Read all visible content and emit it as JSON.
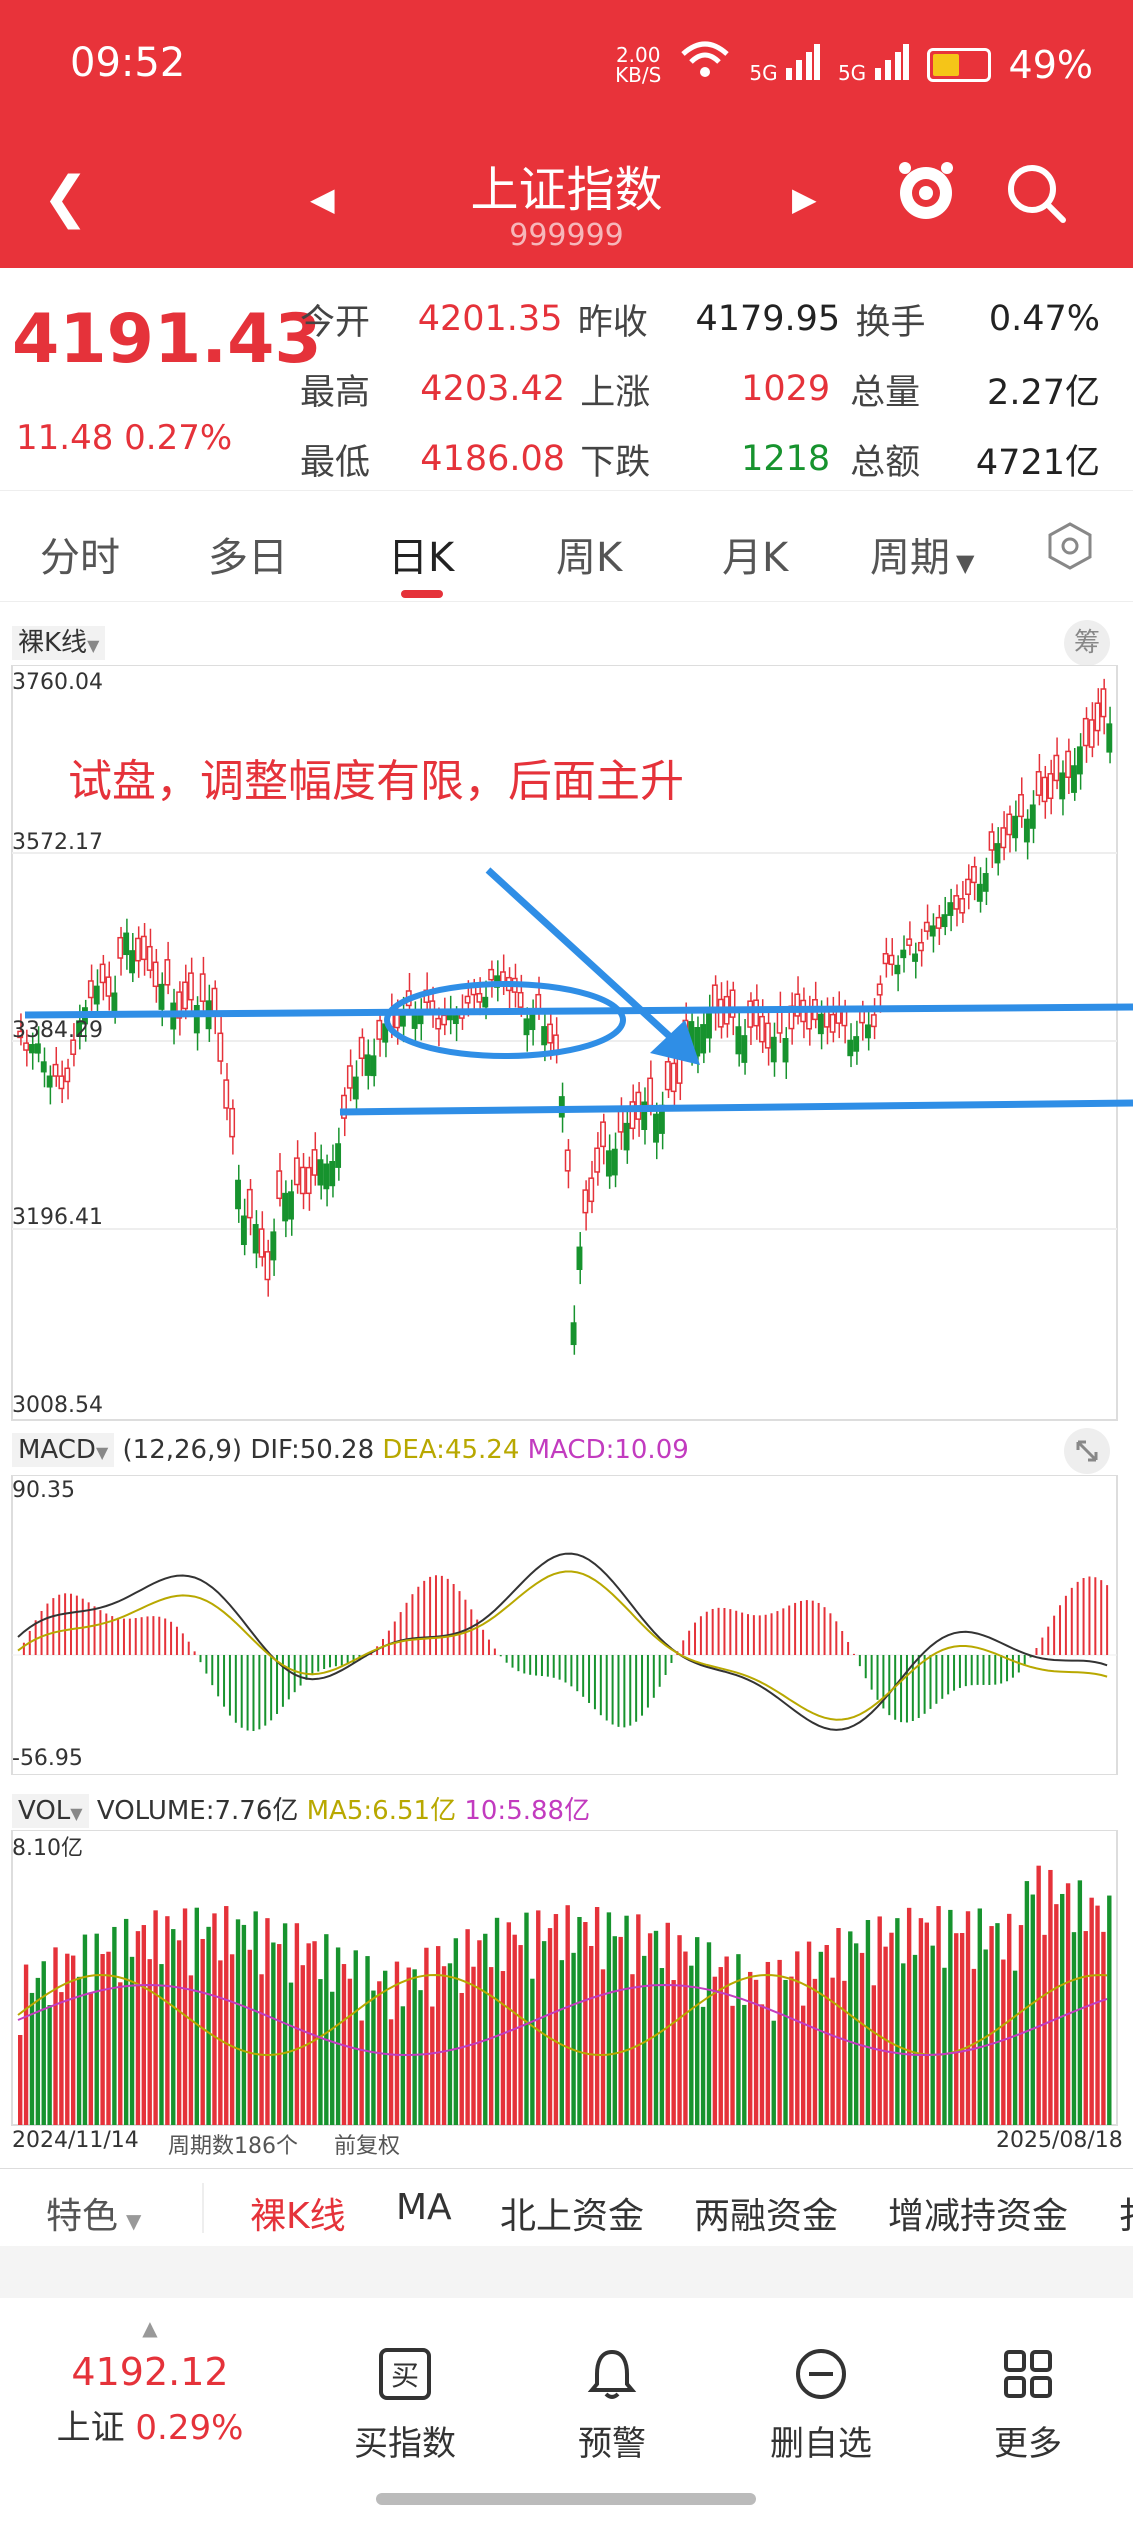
{
  "status_bar": {
    "time": "09:52",
    "speed_value": "2.00",
    "speed_unit": "KB/S",
    "net1": "5G",
    "net2": "5G",
    "battery": "49%"
  },
  "header": {
    "title": "上证指数",
    "code": "999999"
  },
  "quote": {
    "price": "4191.43",
    "change": "11.48 0.27%",
    "rows": [
      {
        "l1": "今开",
        "v1": "4201.35",
        "l2": "昨收",
        "v2": "4179.95",
        "l3": "换手",
        "v3": "0.47%"
      },
      {
        "l1": "最高",
        "v1": "4203.42",
        "l2": "上涨",
        "v2": "1029",
        "l3": "总量",
        "v3": "2.27亿"
      },
      {
        "l1": "最低",
        "v1": "4186.08",
        "l2": "下跌",
        "v2": "1218",
        "l3": "总额",
        "v3": "4721亿"
      }
    ]
  },
  "tabs": [
    "分时",
    "多日",
    "日K",
    "周K",
    "月K",
    "周期"
  ],
  "kline": {
    "mode": "裸K线",
    "badge": "筹",
    "y_labels": [
      "3760.04",
      "3572.17",
      "3384.29",
      "3196.41",
      "3008.54"
    ],
    "annotation": "试盘，调整幅度有限，后面主升"
  },
  "macd": {
    "name": "MACD",
    "params": "(12,26,9)",
    "dif": "DIF:50.28",
    "dea": "DEA:45.24",
    "macd": "MACD:10.09",
    "ymax": "90.35",
    "ymin": "-56.95"
  },
  "vol": {
    "name": "VOL",
    "volume": "VOLUME:7.76亿",
    "ma5": "MA5:6.51亿",
    "ma10": "10:5.88亿",
    "ymax": "8.10亿"
  },
  "x_axis": {
    "start": "2024/11/14",
    "periods": "周期数186个",
    "adj": "前复权",
    "end": "2025/08/18"
  },
  "feature_tabs": [
    "特色",
    "裸K线",
    "MA",
    "北上资金",
    "两融资金",
    "增减持资金",
    "扌"
  ],
  "bottom_nav": {
    "price": "4192.12",
    "index_name": "上证",
    "index_chg": "0.29%",
    "items": [
      {
        "label": "买指数",
        "icon": "buy-icon"
      },
      {
        "label": "预警",
        "icon": "bell-icon"
      },
      {
        "label": "删自选",
        "icon": "minus-circle-icon"
      },
      {
        "label": "更多",
        "icon": "grid-icon"
      }
    ]
  },
  "colors": {
    "up": "#e5323a",
    "down": "#17932e",
    "brand": "#e8333a",
    "annotation_line": "#2f8ee6"
  },
  "chart_data": {
    "type": "candlestick",
    "y_range": [
      3008.54,
      3760.04
    ],
    "last_close": 4191.43,
    "series": [
      {
        "name": "MACD",
        "DIF": 50.28,
        "DEA": 45.24,
        "MACD": 10.09
      }
    ],
    "volume_max": "8.10亿"
  }
}
